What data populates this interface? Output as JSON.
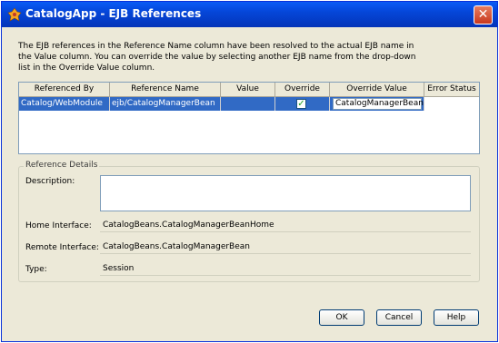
{
  "window": {
    "title": "CatalogApp - EJB References",
    "close_icon": "close-icon"
  },
  "description": "The EJB references in the Reference Name column have been resolved to the actual EJB name in the Value column.  You can override the value by selecting another EJB name from the drop-down list in the Override Value column.",
  "table": {
    "columns": [
      "Referenced By",
      "Reference Name",
      "Value",
      "Override",
      "Override Value",
      "Error Status"
    ],
    "rows": [
      {
        "referenced_by": "Catalog/WebModule",
        "reference_name": "ejb/CatalogManagerBean",
        "value": "",
        "override": true,
        "override_value": "CatalogManagerBean",
        "error_status": ""
      }
    ]
  },
  "details": {
    "legend": "Reference Details",
    "description_label": "Description:",
    "description_value": "",
    "home_label": "Home Interface:",
    "home_value": "CatalogBeans.CatalogManagerBeanHome",
    "remote_label": "Remote Interface:",
    "remote_value": "CatalogBeans.CatalogManagerBean",
    "type_label": "Type:",
    "type_value": "Session"
  },
  "buttons": {
    "ok": "OK",
    "cancel": "Cancel",
    "help": "Help"
  },
  "colors": {
    "title_bar": "#0546d9",
    "selection": "#316ac5",
    "dialog_bg": "#ece9d8"
  }
}
